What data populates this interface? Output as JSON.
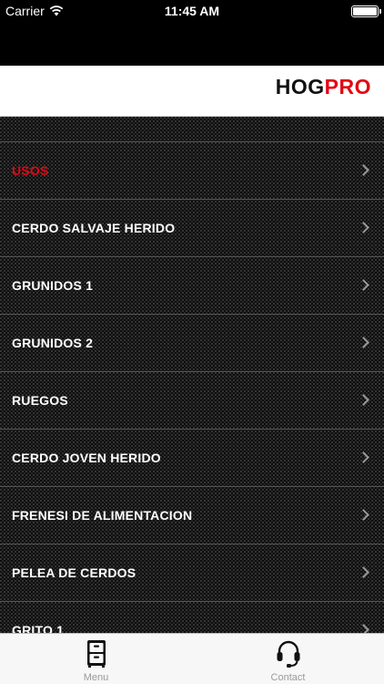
{
  "status_bar": {
    "carrier": "Carrier",
    "time": "11:45 AM",
    "icons": [
      "wifi-icon",
      "battery-icon"
    ]
  },
  "header": {
    "brand_part1": "HOG",
    "brand_part2": "PRO",
    "brand_part1_color": "#111111",
    "brand_part2_color": "#e30613"
  },
  "menu": {
    "active_color": "#e30613",
    "items": [
      {
        "label": "USOS",
        "active": true
      },
      {
        "label": "CERDO SALVAJE HERIDO"
      },
      {
        "label": "GRUNIDOS 1"
      },
      {
        "label": "GRUNIDOS 2"
      },
      {
        "label": "RUEGOS"
      },
      {
        "label": "CERDO JOVEN HERIDO"
      },
      {
        "label": "FRENESI DE ALIMENTACION"
      },
      {
        "label": "PELEA DE CERDOS"
      },
      {
        "label": "GRITO 1"
      }
    ]
  },
  "tab_bar": {
    "tabs": [
      {
        "label": "Menu",
        "icon": "file-cabinet-icon"
      },
      {
        "label": "Contact",
        "icon": "headset-icon"
      }
    ]
  }
}
